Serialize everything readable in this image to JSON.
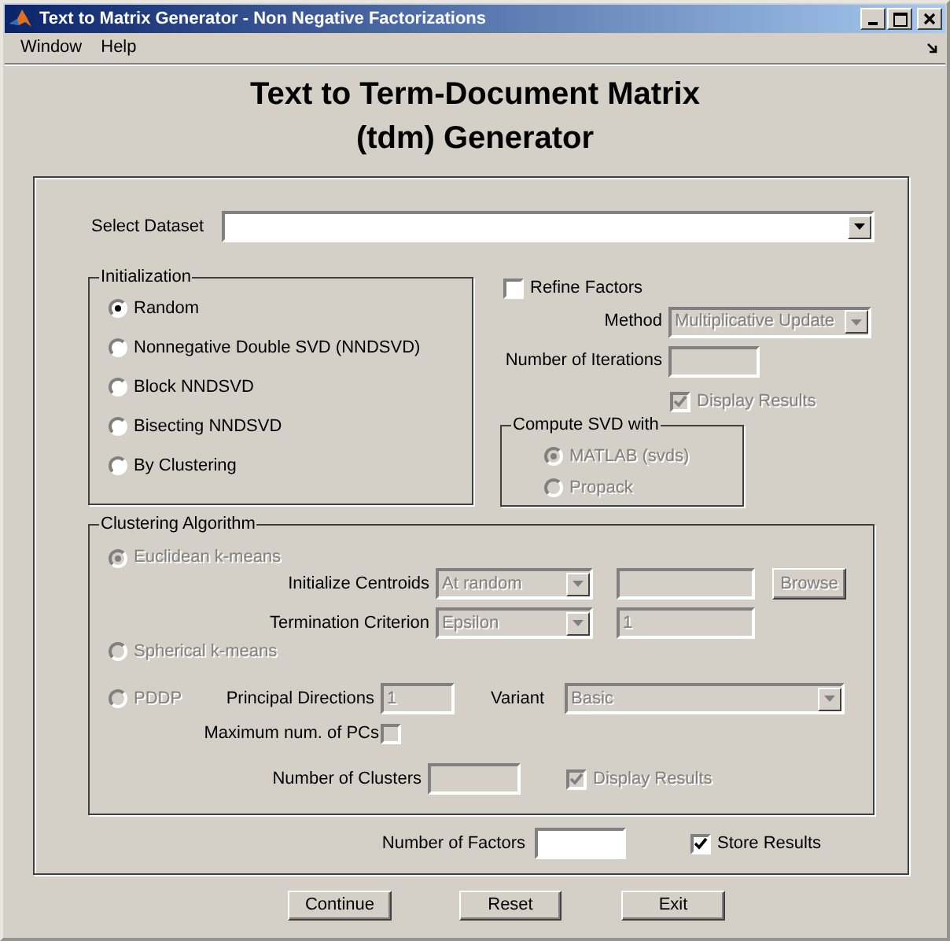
{
  "window": {
    "title": "Text to Matrix Generator - Non Negative Factorizations"
  },
  "menu": [
    {
      "label": "Window"
    },
    {
      "label": "Help"
    }
  ],
  "heading": [
    "Text to Term-Document Matrix",
    "(tdm) Generator"
  ],
  "dataset": {
    "label": "Select Dataset",
    "disabled": false
  },
  "initialization": {
    "title": "Initialization",
    "options": [
      {
        "label": "Random",
        "selected": true
      },
      {
        "label": "Nonnegative Double SVD (NNDSVD)",
        "selected": false
      },
      {
        "label": "Block NNDSVD",
        "selected": false
      },
      {
        "label": "Bisecting NNDSVD",
        "selected": false
      },
      {
        "label": "By Clustering",
        "selected": false
      }
    ]
  },
  "refine": {
    "label": "Refine Factors",
    "checked": false,
    "disabled": false
  },
  "method": {
    "label": "Method",
    "value": "Multiplicative Update",
    "disabled": true
  },
  "iterations": {
    "label": "Number of Iterations",
    "disabled": true
  },
  "refine_display": {
    "label": "Display Results",
    "checked": true,
    "disabled": true
  },
  "svd": {
    "title": "Compute SVD with",
    "options": [
      {
        "label": "MATLAB (svds)",
        "selected": true,
        "disabled": true
      },
      {
        "label": "Propack",
        "selected": false,
        "disabled": true
      }
    ]
  },
  "clustering": {
    "title": "Clustering Algorithm",
    "algorithms": [
      {
        "label": "Euclidean k-means",
        "selected": true,
        "disabled": true
      },
      {
        "label": "Spherical k-means",
        "selected": false,
        "disabled": true
      },
      {
        "label": "PDDP",
        "selected": false,
        "disabled": true
      }
    ],
    "init_centroids": {
      "label": "Initialize Centroids",
      "value": "At random",
      "disabled": true
    },
    "centroids_file": {
      "disabled": true
    },
    "browse": {
      "label": "Browse",
      "disabled": true
    },
    "termination": {
      "label": "Termination Criterion",
      "value": "Epsilon",
      "disabled": true
    },
    "termination_value": {
      "value": "1",
      "disabled": true
    },
    "principal_directions": {
      "label": "Principal Directions",
      "value": "1",
      "disabled": true
    },
    "variant": {
      "label": "Variant",
      "value": "Basic",
      "disabled": true
    },
    "max_pcs": {
      "label": "Maximum num. of PCs",
      "checked": false,
      "disabled": true
    },
    "num_clusters": {
      "label": "Number of Clusters",
      "disabled": true
    },
    "display_results": {
      "label": "Display Results",
      "checked": true,
      "disabled": true
    }
  },
  "factors": {
    "label": "Number of Factors",
    "disabled": false
  },
  "store": {
    "label": "Store Results",
    "checked": true,
    "disabled": false
  },
  "buttons": [
    {
      "label": "Continue"
    },
    {
      "label": "Reset"
    },
    {
      "label": "Exit"
    }
  ]
}
